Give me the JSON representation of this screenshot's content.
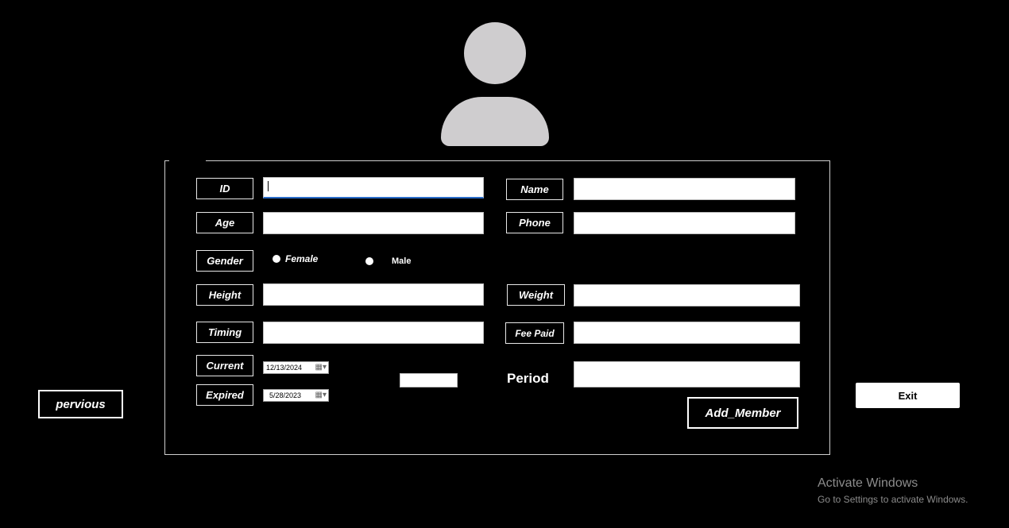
{
  "form": {
    "labels": {
      "id": "ID",
      "name": "Name",
      "age": "Age",
      "phone": "Phone",
      "gender": "Gender",
      "height": "Height",
      "weight": "Weight",
      "timing": "Timing",
      "fee_paid": "Fee Paid",
      "current": "Current",
      "expired": "Expired",
      "period": "Period"
    },
    "values": {
      "id": "",
      "name": "",
      "age": "",
      "phone": "",
      "height": "",
      "weight": "",
      "timing": "",
      "fee_paid": "",
      "period": "",
      "small_box": ""
    },
    "gender_options": {
      "female": "Female",
      "male": "Male"
    },
    "dates": {
      "current": "12/13/2024",
      "expired": "5/28/2023"
    }
  },
  "buttons": {
    "previous": "pervious",
    "add_member": "Add_Member",
    "exit": "Exit"
  },
  "watermark": {
    "title": "Activate Windows",
    "subtitle": "Go to Settings to activate Windows."
  },
  "icons": {
    "avatar": "user-silhouette-icon",
    "calendar": "calendar-dropdown-icon"
  },
  "colors": {
    "background": "#000000",
    "avatar": "#cfcdcf",
    "focus": "#2b6cc9"
  }
}
